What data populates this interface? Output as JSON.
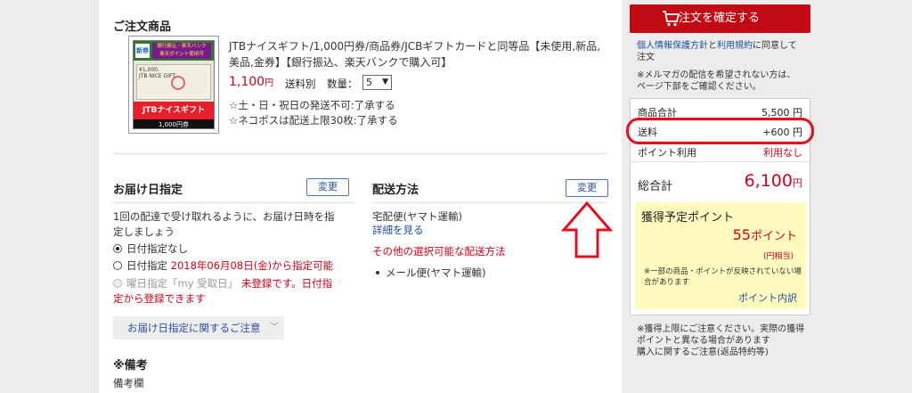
{
  "order_items": {
    "title": "ご注文商品",
    "product_line1": "JTBナイスギフト/1,000円券/商品券/JCBギフトカードと同等品【未使用,新品,",
    "product_line2": "美品,金券】【銀行振込、楽天バンクで購入可】",
    "price_value": "1,100",
    "price_unit": "円",
    "shipping_label": "送料別",
    "qty_label": "数量：",
    "qty_value": "5",
    "note1": "☆土・日・祝日の発送不可:了承する",
    "note2": "☆ネコポスは配送上限30枚:了承する",
    "thumb": {
      "new_badge": "新券",
      "top_banner": "銀行振込・楽天バンク\n楽天ポイント使用可",
      "bill_text": "¥1,000.\nJTB NICE GIFT",
      "brand": "JTBナイスギフト",
      "denomination": "1,000円券"
    }
  },
  "delivery_date": {
    "title": "お届け日指定",
    "change_label": "変更",
    "desc1": "1回の配達で受け取れるように、お届け日時を指",
    "desc2": "定しましょう",
    "opt1": "日付指定なし",
    "opt2_prefix": "日付指定",
    "opt2_red": "2018年06月08日(金)から指定可能",
    "opt3_prefix": "曜日指定「my 受取日」",
    "opt3_red1": "未登録です。日付指",
    "opt3_red2": "定から登録できます",
    "notice": "お届け日指定に関するご注意"
  },
  "shipping_method": {
    "title": "配送方法",
    "change_label": "変更",
    "method": "宅配便(ヤマト運輸)",
    "details_link": "詳細を見る",
    "other_title": "その他の選択可能な配送方法",
    "other_item": "メール便(ヤマト運輸)"
  },
  "remarks": {
    "title": "※備考",
    "label": "備考欄"
  },
  "sidebar": {
    "confirm_label": "注文を確定する",
    "policy_link1": "個人情報保護方針",
    "policy_mid": "と",
    "policy_link2": "利用規約",
    "policy_tail1": "に同意して",
    "policy_tail2": "注文",
    "newsletter1": "※メルマガの配信を希望されない方は、",
    "newsletter2": "ページ下部をご確認ください。",
    "subtotal_label": "商品合計",
    "subtotal_value": "5,500 円",
    "shipping_label": "送料",
    "shipping_value": "+600 円",
    "points_label": "ポイント利用",
    "points_value": "利用なし",
    "total_label": "総合計",
    "total_value": "6,100",
    "total_unit": "円",
    "earn_title": "獲得予定ポイント",
    "earn_value": "55",
    "earn_unit": "ポイント",
    "earn_yen": "(円相当)",
    "earn_note1": "※一部の商品・ポイントが反映されていない場",
    "earn_note2": "合があります",
    "earn_link": "ポイント内訳",
    "footer1": "※獲得上限にご注意ください。実際の獲得",
    "footer2": "ポイントと異なる場合があります",
    "footer_link": "購入に関するご注意(返品特約等)"
  },
  "colors": {
    "accent_red": "#c20a14",
    "price_red": "#d0021b",
    "link_blue": "#1a4fa0",
    "points_bg": "#fffbbf"
  }
}
